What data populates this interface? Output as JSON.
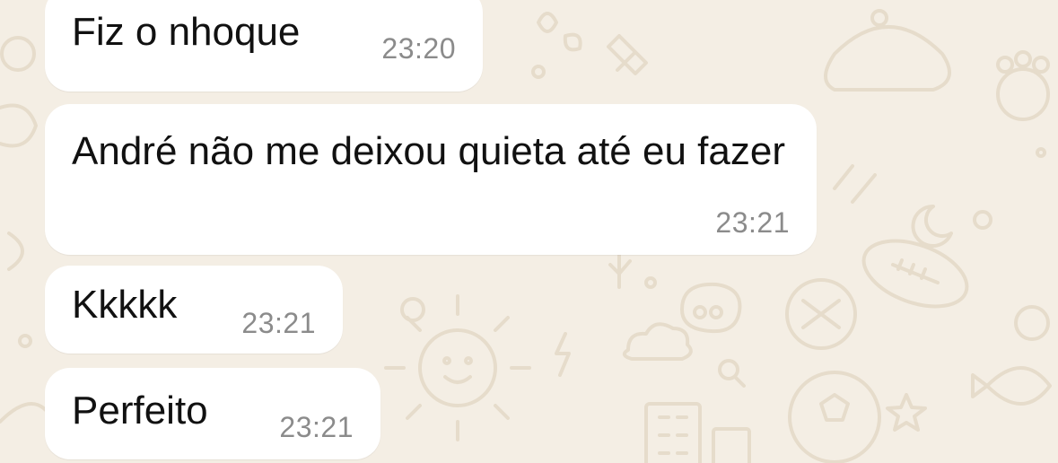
{
  "chat": {
    "messages": [
      {
        "text": "Fiz o nhoque",
        "time": "23:20"
      },
      {
        "text": "André não me deixou quieta até eu fazer",
        "time": "23:21"
      },
      {
        "text": "Kkkkk",
        "time": "23:21"
      },
      {
        "text": "Perfeito",
        "time": "23:21"
      }
    ]
  },
  "colors": {
    "wallpaper": "#f4eee4",
    "doodle": "#e6dccb",
    "bubble": "#ffffff",
    "text": "#111111",
    "timestamp": "#8b8b8b"
  }
}
